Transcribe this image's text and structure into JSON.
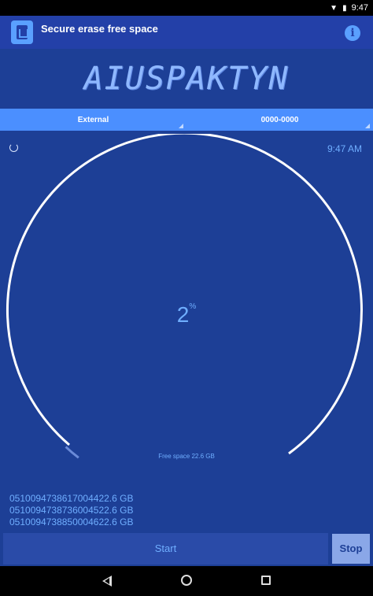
{
  "status_bar": {
    "time": "9:47"
  },
  "app_bar": {
    "title": "Secure erase free space",
    "info_icon": "info-icon"
  },
  "banner": {
    "text": "AIUSPAKTYN"
  },
  "spinners": {
    "storage": "External",
    "pattern": "0000-0000"
  },
  "progress": {
    "time": "9:47 AM",
    "percent": "2",
    "percent_suffix": "%",
    "percent_value": 2,
    "free_space": "Free space 22.6 GB"
  },
  "log": [
    "0510094738617004422.6 GB",
    "0510094738736004522.6 GB",
    "0510094738850004622.6 GB"
  ],
  "buttons": {
    "start": "Start",
    "stop": "Stop"
  }
}
